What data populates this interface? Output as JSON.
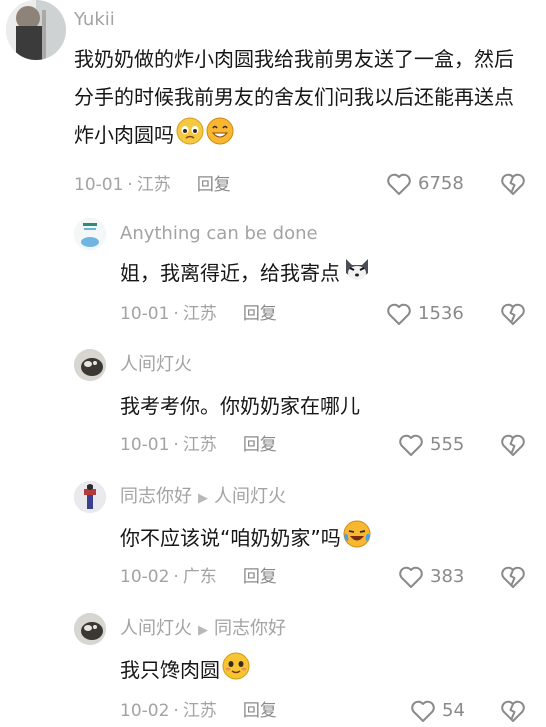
{
  "comments": [
    {
      "user": "Yukii",
      "text": "我奶奶做的炸小肉圆我给我前男友送了一盒，然后分手的时候我前男友的舍友们问我以后还能再送点炸小肉圆吗",
      "date": "10-01",
      "location": "江苏",
      "reply": "回复",
      "likes": "6758"
    },
    {
      "user": "Anything can be done",
      "text": "姐，我离得近，给我寄点",
      "date": "10-01",
      "location": "江苏",
      "reply": "回复",
      "likes": "1536"
    },
    {
      "user": "人间灯火",
      "text": "我考考你。你奶奶家在哪儿",
      "date": "10-01",
      "location": "江苏",
      "reply": "回复",
      "likes": "555"
    },
    {
      "user": "同志你好",
      "reply_to": "人间灯火",
      "text": "你不应该说“咱奶奶家”吗",
      "date": "10-02",
      "location": "广东",
      "reply": "回复",
      "likes": "383"
    },
    {
      "user": "人间灯火",
      "reply_to": "同志你好",
      "text": "我只馋肉圆",
      "date": "10-02",
      "location": "江苏",
      "reply": "回复",
      "likes": "54"
    }
  ],
  "icons": {
    "like": "heart-outline-icon",
    "dislike": "broken-heart-icon",
    "reply_arrow": "triangle-right-icon"
  },
  "colors": {
    "meta": "#a3a3a3",
    "text": "#161616"
  }
}
